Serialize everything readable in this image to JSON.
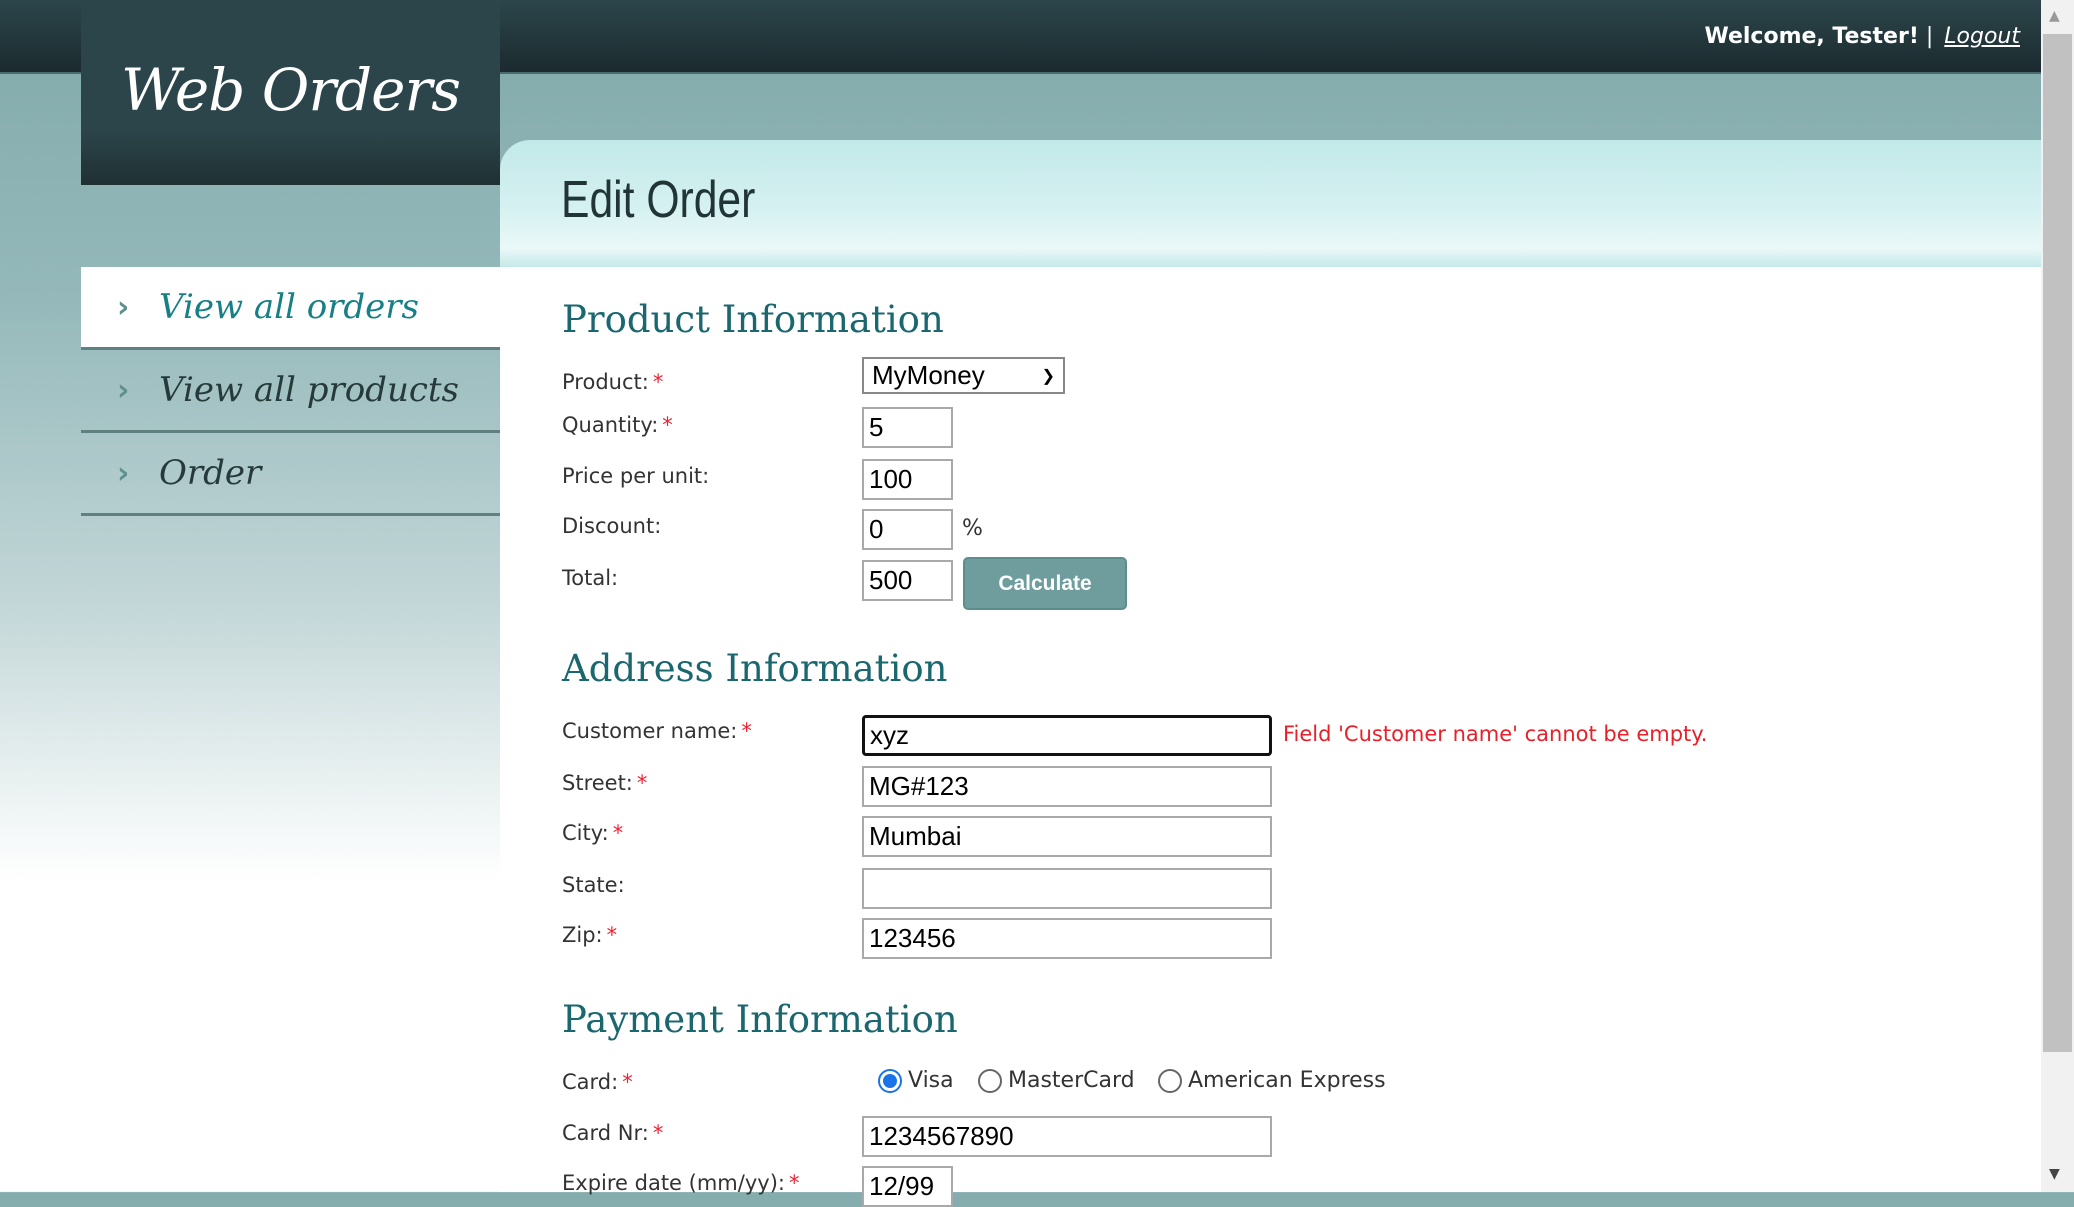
{
  "header": {
    "app_title": "Web Orders",
    "welcome": "Welcome, Tester!",
    "separator": "|",
    "logout": "Logout"
  },
  "sidebar": {
    "items": [
      {
        "label": "View all orders",
        "active": true
      },
      {
        "label": "View all products"
      },
      {
        "label": "Order"
      }
    ],
    "chevron": "›"
  },
  "page": {
    "title": "Edit Order"
  },
  "product": {
    "heading": "Product Information",
    "product_label": "Product:",
    "product_value": "MyMoney",
    "quantity_label": "Quantity:",
    "quantity_value": "5",
    "price_label": "Price per unit:",
    "price_value": "100",
    "discount_label": "Discount:",
    "discount_value": "0",
    "percent": "%",
    "total_label": "Total:",
    "total_value": "500",
    "calculate": "Calculate"
  },
  "address": {
    "heading": "Address Information",
    "customer_label": "Customer name:",
    "customer_value": "xyz",
    "error": "Field 'Customer name' cannot be empty.",
    "street_label": "Street:",
    "street_value": "MG#123",
    "city_label": "City:",
    "city_value": "Mumbai",
    "state_label": "State:",
    "state_value": "",
    "zip_label": "Zip:",
    "zip_value": "123456"
  },
  "payment": {
    "heading": "Payment Information",
    "card_label": "Card:",
    "cards": [
      "Visa",
      "MasterCard",
      "American Express"
    ],
    "selected_card": "Visa",
    "cardnr_label": "Card Nr:",
    "cardnr_value": "1234567890",
    "expire_label": "Expire date (mm/yy):",
    "expire_value": "12/99"
  },
  "required_mark": "*"
}
